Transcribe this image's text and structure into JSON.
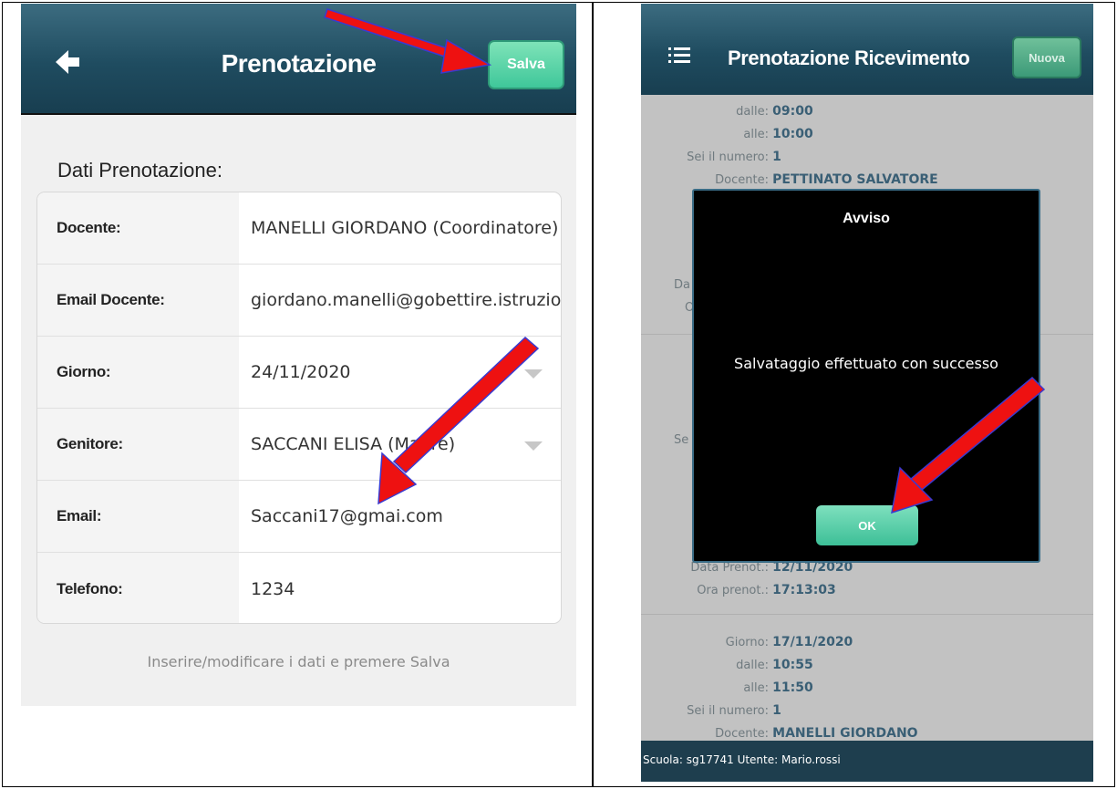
{
  "left_panel": {
    "header": {
      "title": "Prenotazione",
      "save_label": "Salva"
    },
    "section_title": "Dati Prenotazione:",
    "fields": [
      {
        "label": "Docente:",
        "value": "MANELLI GIORDANO (Coordinatore)",
        "dropdown": false
      },
      {
        "label": "Email Docente:",
        "value": "giordano.manelli@gobettire.istruzioneer.it",
        "dropdown": false
      },
      {
        "label": "Giorno:",
        "value": "24/11/2020",
        "dropdown": true
      },
      {
        "label": "Genitore:",
        "value": "SACCANI ELISA (Madre)",
        "dropdown": true
      },
      {
        "label": "Email:",
        "value": "Saccani17@gmai.com",
        "dropdown": false
      },
      {
        "label": "Telefono:",
        "value": "1234",
        "dropdown": false
      }
    ],
    "hint": "Inserire/modificare i dati e premere Salva"
  },
  "right_panel": {
    "header": {
      "title": "Prenotazione Ricevimento",
      "new_label": "Nuova"
    },
    "entry1": {
      "dalle_label": "dalle:",
      "dalle_value": "09:00",
      "alle_label": "alle:",
      "alle_value": "10:00",
      "numero_label": "Sei il numero:",
      "numero_value": "1",
      "docente_label": "Docente:",
      "docente_value": "PETTINATO SALVATORE",
      "data_prenot_label": "Da",
      "ora_prenot_label": "O"
    },
    "entry2": {
      "sei_label": "Se",
      "data_prenot_label": "Data Prenot.:",
      "data_prenot_value": "12/11/2020",
      "ora_prenot_label": "Ora prenot.:",
      "ora_prenot_value": "17:13:03"
    },
    "entry3": {
      "giorno_label": "Giorno:",
      "giorno_value": "17/11/2020",
      "dalle_label": "dalle:",
      "dalle_value": "10:55",
      "alle_label": "alle:",
      "alle_value": "11:50",
      "numero_label": "Sei il numero:",
      "numero_value": "1",
      "docente_label": "Docente:",
      "docente_value": "MANELLI GIORDANO"
    },
    "dialog": {
      "title": "Avviso",
      "message": "Salvataggio effettuato con successo",
      "ok_label": "OK"
    },
    "status_bar": "Scuola: sg17741 Utente: Mario.rossi"
  },
  "colors": {
    "header_bg": "#1f4c60",
    "accent_green": "#3fc79a",
    "value_blue": "#2c5a75",
    "arrow_red": "#ee1111",
    "arrow_outline": "#3a3ad0"
  }
}
